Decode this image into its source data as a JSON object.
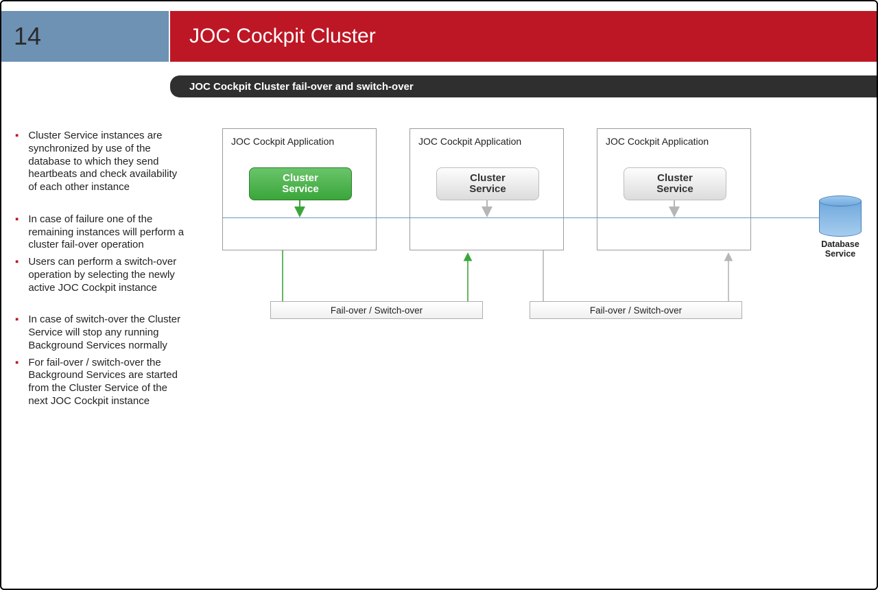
{
  "header": {
    "slide_number": "14",
    "title": "JOC Cockpit Cluster",
    "subtitle": "JOC Cockpit Cluster fail-over and switch-over"
  },
  "bullets": {
    "group1": [
      "Cluster Service instances are synchronized by use of the database to which they send heartbeats and check availability of each other instance"
    ],
    "group2": [
      "In case of failure one of the remaining instances will perform a cluster fail-over operation",
      "Users can perform a switch-over operation by selecting the newly active JOC Cockpit instance"
    ],
    "group3": [
      "In case of switch-over the Cluster Service will stop any running Background Services normally",
      "For fail-over / switch-over the Background Services are started from the Cluster Service of the next JOC Cockpit instance"
    ]
  },
  "diagram": {
    "app_label": "JOC Cockpit Application",
    "cluster_line1": "Cluster",
    "cluster_line2": "Service",
    "db_line1": "Database",
    "db_line2": "Service",
    "failover_label": "Fail-over / Switch-over"
  }
}
